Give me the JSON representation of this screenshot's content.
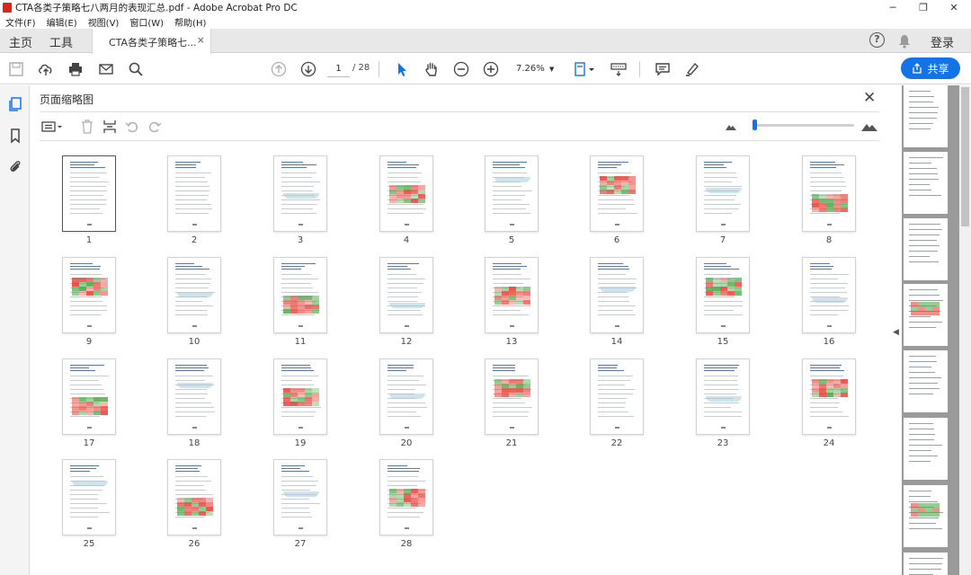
{
  "window": {
    "title": "CTA各类子策略七八两月的表现汇总.pdf - Adobe Acrobat Pro DC",
    "minimize": "─",
    "restore": "❐",
    "close": "✕"
  },
  "menu": [
    "文件(F)",
    "编辑(E)",
    "视图(V)",
    "窗口(W)",
    "帮助(H)"
  ],
  "tabs": {
    "home": "主页",
    "tools": "工具",
    "document": "CTA各类子策略七...",
    "close": "×",
    "help": "?",
    "signin": "登录"
  },
  "toolbar": {
    "current_page": "1",
    "total_pages": "/ 28",
    "zoom": "7.26%",
    "share_label": "共享"
  },
  "panel": {
    "title": "页面缩略图",
    "close": "✕"
  },
  "thumbnails": {
    "labels": [
      "1",
      "2",
      "3",
      "4",
      "5",
      "6",
      "7",
      "8",
      "9",
      "10",
      "11",
      "12",
      "13",
      "14",
      "15",
      "16",
      "17",
      "18",
      "19",
      "20",
      "21",
      "22",
      "23",
      "24",
      "25",
      "26",
      "27",
      "28"
    ],
    "selected_page": 1
  },
  "colors": {
    "accent": "#1473e6",
    "heat_red": "#e8443a",
    "heat_green": "#4caa48"
  },
  "icons": [
    "save-icon",
    "cloud-upload-icon",
    "print-icon",
    "email-icon",
    "search-icon",
    "page-up-icon",
    "page-down-icon",
    "cursor-icon",
    "hand-icon",
    "zoom-out-icon",
    "zoom-in-icon",
    "fit-page-icon",
    "keyboard-icon",
    "comment-icon",
    "highlight-icon",
    "share-icon",
    "pages-icon",
    "bookmark-icon",
    "attachment-icon",
    "options-icon",
    "delete-icon",
    "insert-icon",
    "rotate-left-icon",
    "rotate-right-icon",
    "small-mountain-icon",
    "large-mountain-icon",
    "help-icon",
    "bell-icon"
  ]
}
